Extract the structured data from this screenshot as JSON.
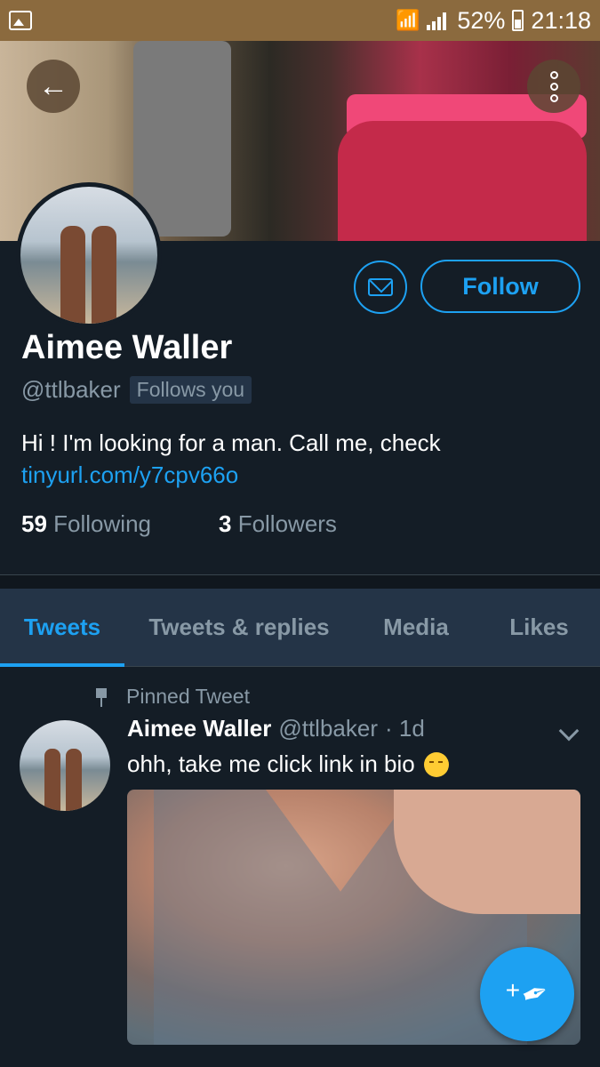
{
  "status_bar": {
    "battery": "52%",
    "time": "21:18"
  },
  "profile": {
    "name": "Aimee Waller",
    "handle": "@ttlbaker",
    "follows_badge": "Follows you",
    "bio_text": "Hi ! I'm looking for a man. Call me, check",
    "bio_link": "tinyurl.com/y7cpv66o",
    "following_count": "59",
    "following_label": "Following",
    "followers_count": "3",
    "followers_label": "Followers",
    "follow_button": "Follow"
  },
  "tabs": [
    {
      "label": "Tweets",
      "active": true
    },
    {
      "label": "Tweets & replies",
      "active": false
    },
    {
      "label": "Media",
      "active": false
    },
    {
      "label": "Likes",
      "active": false
    }
  ],
  "tweet": {
    "pinned_label": "Pinned Tweet",
    "author_name": "Aimee Waller",
    "author_handle": "@ttlbaker",
    "time_ago": "· 1d",
    "text": "ohh, take me click link in bio"
  },
  "icons": {
    "back": "arrow-left-icon",
    "more": "more-vertical-icon",
    "message": "envelope-icon",
    "pin": "pin-icon",
    "compose": "compose-tweet-icon"
  },
  "colors": {
    "accent": "#1da1f2",
    "background": "#141d26",
    "tabs_bg": "#243447",
    "muted": "#8899a6"
  }
}
